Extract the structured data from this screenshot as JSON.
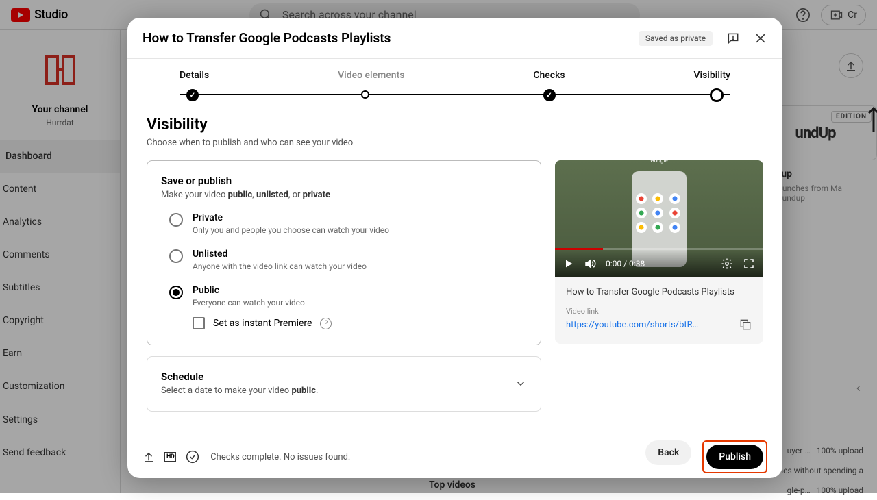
{
  "app": {
    "name": "Studio",
    "search_placeholder": "Search across your channel",
    "create_label": "Cr"
  },
  "channel": {
    "your_channel": "Your channel",
    "name": "Hurrdat"
  },
  "nav": {
    "dashboard": "Dashboard",
    "content": "Content",
    "analytics": "Analytics",
    "comments": "Comments",
    "subtitles": "Subtitles",
    "copyright": "Copyright",
    "earn": "Earn",
    "customization": "Customization",
    "settings": "Settings",
    "feedback": "Send feedback"
  },
  "bg": {
    "roundup": "Roundup",
    "roundup_sub1": "citing launches from Ma",
    "roundup_sub2": "nth's Roundup",
    "edition": "EDITION",
    "card_txt": "undUp",
    "top_videos": "Top videos",
    "row1a": "uyer-…",
    "row1b": "100% upload",
    "row2a": "gle-p…",
    "row2b": "100% upload",
    "row3": "scenes without spending a"
  },
  "dialog": {
    "title": "How to Transfer Google Podcasts Playlists",
    "saved": "Saved as private",
    "steps": {
      "details": "Details",
      "video_elements": "Video elements",
      "checks": "Checks",
      "visibility": "Visibility"
    },
    "visibility": {
      "heading": "Visibility",
      "sub": "Choose when to publish and who can see your video"
    },
    "save_publish": {
      "title": "Save or publish",
      "desc1": "Make your video ",
      "desc_public": "public",
      "desc_unlisted": "unlisted",
      "desc_or": ", or ",
      "desc_private": "private",
      "private": {
        "label": "Private",
        "desc": "Only you and people you choose can watch your video"
      },
      "unlisted": {
        "label": "Unlisted",
        "desc": "Anyone with the video link can watch your video"
      },
      "public_opt": {
        "label": "Public",
        "desc": "Everyone can watch your video"
      },
      "premiere": "Set as instant Premiere"
    },
    "schedule": {
      "title": "Schedule",
      "desc1": "Select a date to make your video ",
      "desc_public": "public"
    },
    "preview": {
      "google": "Google",
      "time": "0:00 / 0:38",
      "title": "How to Transfer Google Podcasts Playlists",
      "link_label": "Video link",
      "url": "https://youtube.com/shorts/btR…"
    },
    "footer": {
      "status": "Checks complete. No issues found.",
      "back": "Back",
      "publish": "Publish",
      "hd": "HD"
    }
  }
}
